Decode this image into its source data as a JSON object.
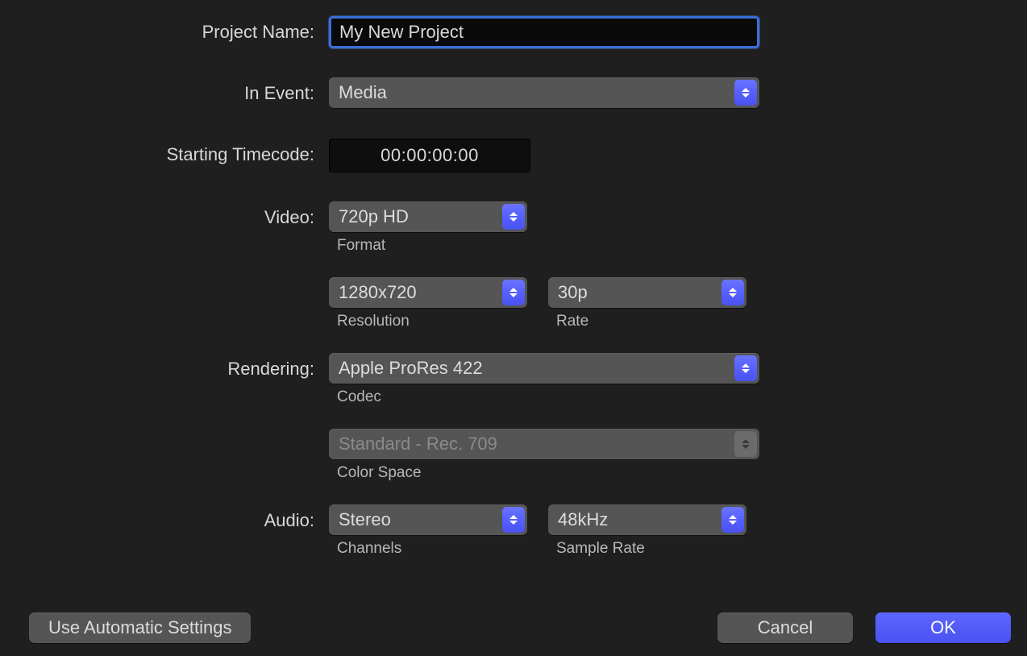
{
  "labels": {
    "project_name": "Project Name:",
    "in_event": "In Event:",
    "starting_timecode": "Starting Timecode:",
    "video": "Video:",
    "rendering": "Rendering:",
    "audio": "Audio:"
  },
  "sublabels": {
    "format": "Format",
    "resolution": "Resolution",
    "rate": "Rate",
    "codec": "Codec",
    "color_space": "Color Space",
    "channels": "Channels",
    "sample_rate": "Sample Rate"
  },
  "fields": {
    "project_name": "My New Project",
    "in_event": "Media",
    "starting_timecode": "00:00:00:00",
    "video_format": "720p HD",
    "resolution": "1280x720",
    "rate": "30p",
    "codec": "Apple ProRes 422",
    "color_space": "Standard - Rec. 709",
    "audio_channels": "Stereo",
    "audio_sample_rate": "48kHz"
  },
  "buttons": {
    "automatic": "Use Automatic Settings",
    "cancel": "Cancel",
    "ok": "OK"
  }
}
